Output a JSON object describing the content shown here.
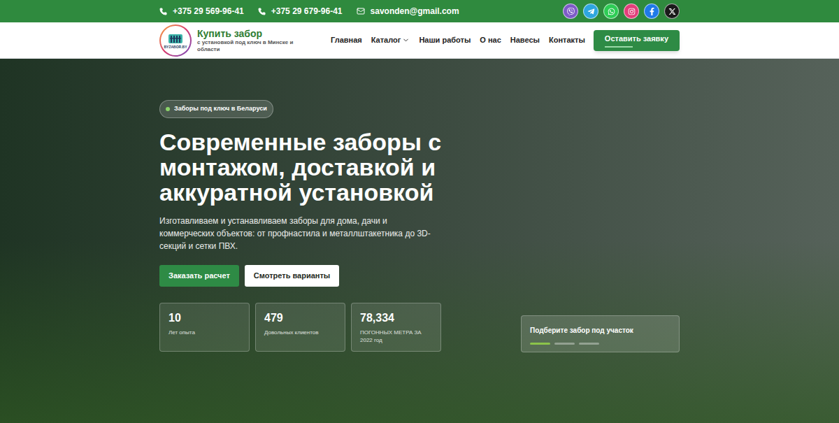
{
  "topbar": {
    "phones": [
      "+375 29 569-96-41",
      "+375 29 679-96-41"
    ],
    "email": "savonden@gmail.com",
    "socials": [
      {
        "color": "#7d5bc7"
      },
      {
        "color": "#2ea6df"
      },
      {
        "color": "#2ecc55"
      },
      {
        "color": "#e23e7a"
      },
      {
        "color": "#1f7ae8"
      },
      {
        "color": "#1a1a1a"
      }
    ]
  },
  "header": {
    "logo_text": "BYZABOR.BY",
    "title": "Купить забор",
    "subtitle": "с установкой под ключ в Минске и области",
    "nav": [
      {
        "label": "Главная",
        "dropdown": false
      },
      {
        "label": "Каталог",
        "dropdown": true
      },
      {
        "label": "Наши работы",
        "dropdown": false
      },
      {
        "label": "О нас",
        "dropdown": false
      },
      {
        "label": "Навесы",
        "dropdown": false
      },
      {
        "label": "Контакты",
        "dropdown": false
      }
    ],
    "cta": "Оставить заявку"
  },
  "hero": {
    "badge": "Заборы под ключ в Беларуси",
    "title": "Современные заборы с монтажом, доставкой и аккуратной установкой",
    "description": "Изготавливаем и устанавливаем заборы для дома, дачи и коммерческих объектов: от профнастила и металлштакетника до 3D-секций и сетки ПВХ.",
    "buttons": [
      "Заказать расчет",
      "Смотреть варианты"
    ],
    "stats": [
      {
        "value": "10",
        "label": "Лет опыта"
      },
      {
        "value": "479",
        "label": "Довольных клиентов"
      },
      {
        "value": "78,334",
        "label": "ПОГОННЫХ МЕТРА ЗА 2022 год"
      }
    ],
    "card": {
      "title": "Подберите забор под участок",
      "slides": [
        {
          "selected": true
        },
        {
          "selected": false
        },
        {
          "selected": false
        }
      ]
    }
  }
}
